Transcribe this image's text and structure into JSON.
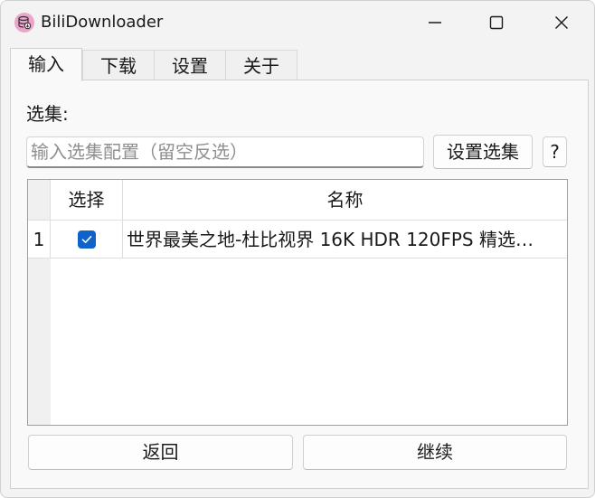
{
  "window": {
    "title": "BiliDownloader"
  },
  "tabs": [
    {
      "label": "输入",
      "active": true
    },
    {
      "label": "下载",
      "active": false
    },
    {
      "label": "设置",
      "active": false
    },
    {
      "label": "关于",
      "active": false
    }
  ],
  "input_panel": {
    "section_label": "选集:",
    "selection_input": {
      "value": "",
      "placeholder": "输入选集配置（留空反选）"
    },
    "set_selection_button": "设置选集",
    "help_button": "?"
  },
  "table": {
    "columns": [
      "选择",
      "名称"
    ],
    "rows": [
      {
        "index": "1",
        "checked": true,
        "name": "世界最美之地-杜比视界 16K HDR 120FPS 精选…"
      }
    ]
  },
  "footer": {
    "back_button": "返回",
    "continue_button": "继续"
  },
  "icons": {
    "app": "database-download-icon",
    "minimize": "minimize-icon",
    "maximize": "maximize-icon",
    "close": "close-icon",
    "check": "checkmark-icon"
  },
  "colors": {
    "accent": "#0f62c9",
    "app_icon_bg": "#e9a6c8"
  }
}
